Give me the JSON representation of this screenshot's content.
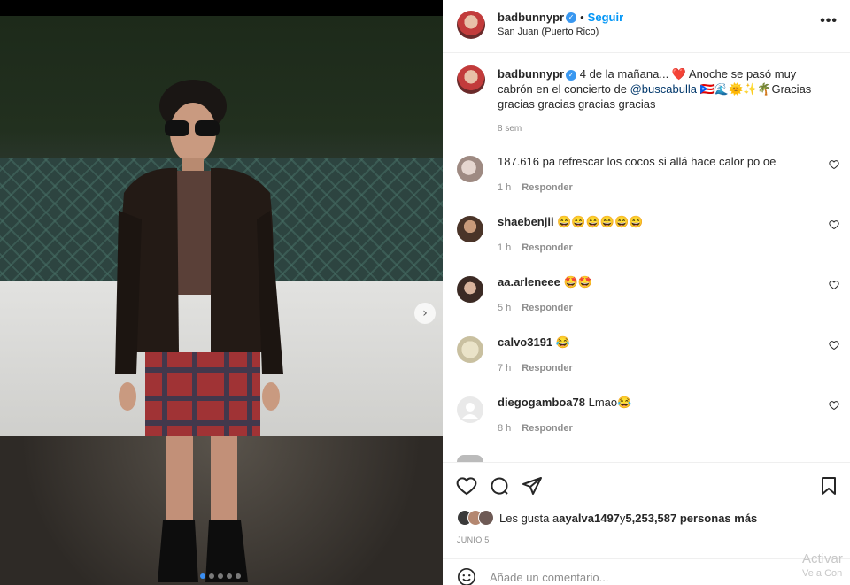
{
  "post": {
    "username": "badbunnypr",
    "follow_label": "Seguir",
    "location": "San Juan (Puerto Rico)",
    "caption_user": "badbunnypr",
    "caption_part1": "4 de la mañana... ",
    "caption_heart": "❤️",
    "caption_part2": " Anoche se pasó muy cabrón en el concierto de ",
    "caption_mention": "@buscabulla",
    "caption_part3": " 🇵🇷🌊🌞✨🌴Gracias gracias gracias gracias gracias",
    "caption_time": "8 sem",
    "more_label": "•••",
    "carousel_next": "›"
  },
  "comments": [
    {
      "user": "",
      "text": "187.616 pa refrescar los cocos si allá hace calor po oe",
      "time": "1 h",
      "reply": "Responder"
    },
    {
      "user": "shaebenjii",
      "text": "😄😄😄😄😄😄",
      "time": "1 h",
      "reply": "Responder"
    },
    {
      "user": "aa.arleneee",
      "text": "🤩🤩",
      "time": "5 h",
      "reply": "Responder"
    },
    {
      "user": "calvo3191",
      "text": "😂",
      "time": "7 h",
      "reply": "Responder"
    },
    {
      "user": "diegogamboa78",
      "text": "Lmao😂",
      "time": "8 h",
      "reply": "Responder"
    }
  ],
  "footer": {
    "likes_prefix": "Les gusta a ",
    "likes_user": "ayalva1497",
    "likes_and": " y ",
    "likes_count": "5,253,587 personas más",
    "date": "JUNIO 5",
    "comment_placeholder": "Añade un comentario...",
    "watermark_line1": "Activar",
    "watermark_line2": "Ve a Con"
  },
  "colors": {
    "follow": "#0095f6",
    "mention": "#00376b",
    "verified": "#3897f0",
    "heart": "#ed4956",
    "muted": "#8e8e8e"
  },
  "icons": [
    "heart-icon",
    "comment-icon",
    "share-icon",
    "bookmark-icon",
    "emoji-icon",
    "more-options-icon",
    "verified-icon",
    "chevron-right-icon"
  ]
}
